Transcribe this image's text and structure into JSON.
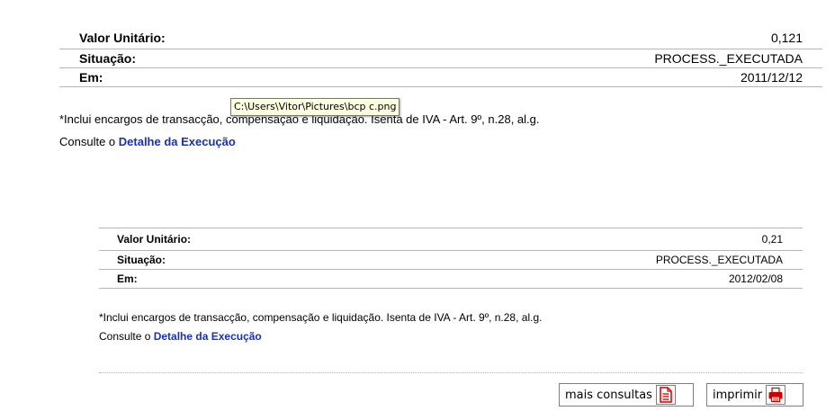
{
  "section1": {
    "rows": [
      {
        "label": "Valor Unitário:",
        "value": "0,121"
      },
      {
        "label": "Situação:",
        "value": "PROCESS._EXECUTADA"
      },
      {
        "label": "Em:",
        "value": "2011/12/12"
      }
    ],
    "note": "*Inclui encargos de transacção, compensação e liquidação. Isenta de IVA - Art. 9º, n.28, al.g.",
    "consult_prefix": "Consulte o ",
    "consult_link": "Detalhe da Execução"
  },
  "tooltip": "C:\\Users\\Vitor\\Pictures\\bcp c.png",
  "section2": {
    "rows": [
      {
        "label": "Valor Unitário:",
        "value": "0,21"
      },
      {
        "label": "Situação:",
        "value": "PROCESS._EXECUTADA"
      },
      {
        "label": "Em:",
        "value": "2012/02/08"
      }
    ],
    "note": "*Inclui encargos de transacção, compensação e liquidação. Isenta de IVA - Art. 9º, n.28, al.g.",
    "consult_prefix": "Consulte o ",
    "consult_link": "Detalhe da Execução"
  },
  "actions": {
    "more_label": "mais consultas",
    "more_icon": "document-icon",
    "print_label": "imprimir",
    "print_icon": "printer-icon",
    "icon_color": "#cc0000"
  }
}
